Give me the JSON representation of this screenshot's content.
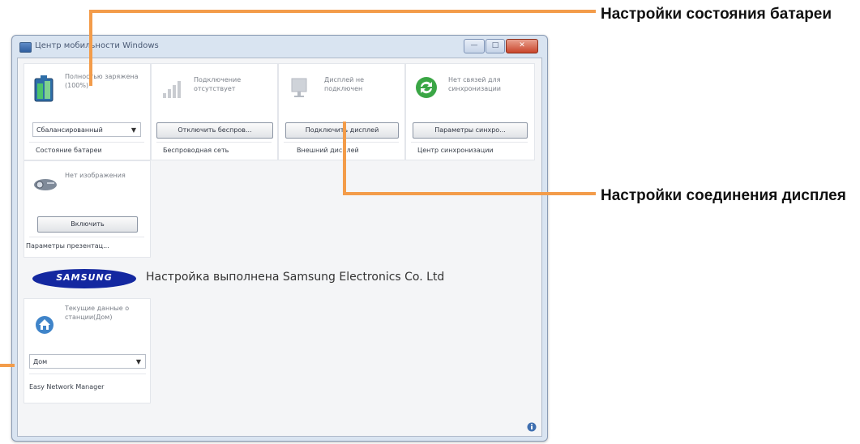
{
  "window": {
    "title": "Центр мобильности Windows",
    "buttons": {
      "minimize": "—",
      "maximize": "□",
      "close": "✕"
    },
    "status_icon": "info-icon"
  },
  "tiles": {
    "battery": {
      "icon": "battery-icon",
      "status": "Полностью заряжена (100%)",
      "control": "Сбалансированный",
      "caption": "Состояние батареи"
    },
    "wireless": {
      "icon": "wireless-signal-icon",
      "status": "Подключение отсутствует",
      "button": "Отключить беспров...",
      "caption": "Беспроводная сеть"
    },
    "display": {
      "icon": "external-display-icon",
      "status": "Дисплей не подключен",
      "button": "Подключить дисплей",
      "caption": "Внешний дисплей"
    },
    "sync": {
      "icon": "sync-icon",
      "status": "Нет связей для синхронизации",
      "button": "Параметры синхро...",
      "caption": "Центр синхронизации"
    },
    "presentation": {
      "icon": "projector-icon",
      "status": "Нет изображения",
      "button": "Включить",
      "caption": "Параметры презентац..."
    },
    "network": {
      "icon": "home-network-icon",
      "status": "Текущие данные о станции(Дом)",
      "control": "Дом",
      "caption": "Easy Network Manager"
    }
  },
  "samsung": {
    "logo_text": "SAMSUNG",
    "banner": "Настройка выполнена Samsung Electronics Co. Ltd"
  },
  "callouts": {
    "battery": "Настройки состояния батареи",
    "display": "Настройки соединения дисплея"
  },
  "colors": {
    "callout_line": "#f39c4a",
    "samsung_blue": "#1428a0"
  }
}
